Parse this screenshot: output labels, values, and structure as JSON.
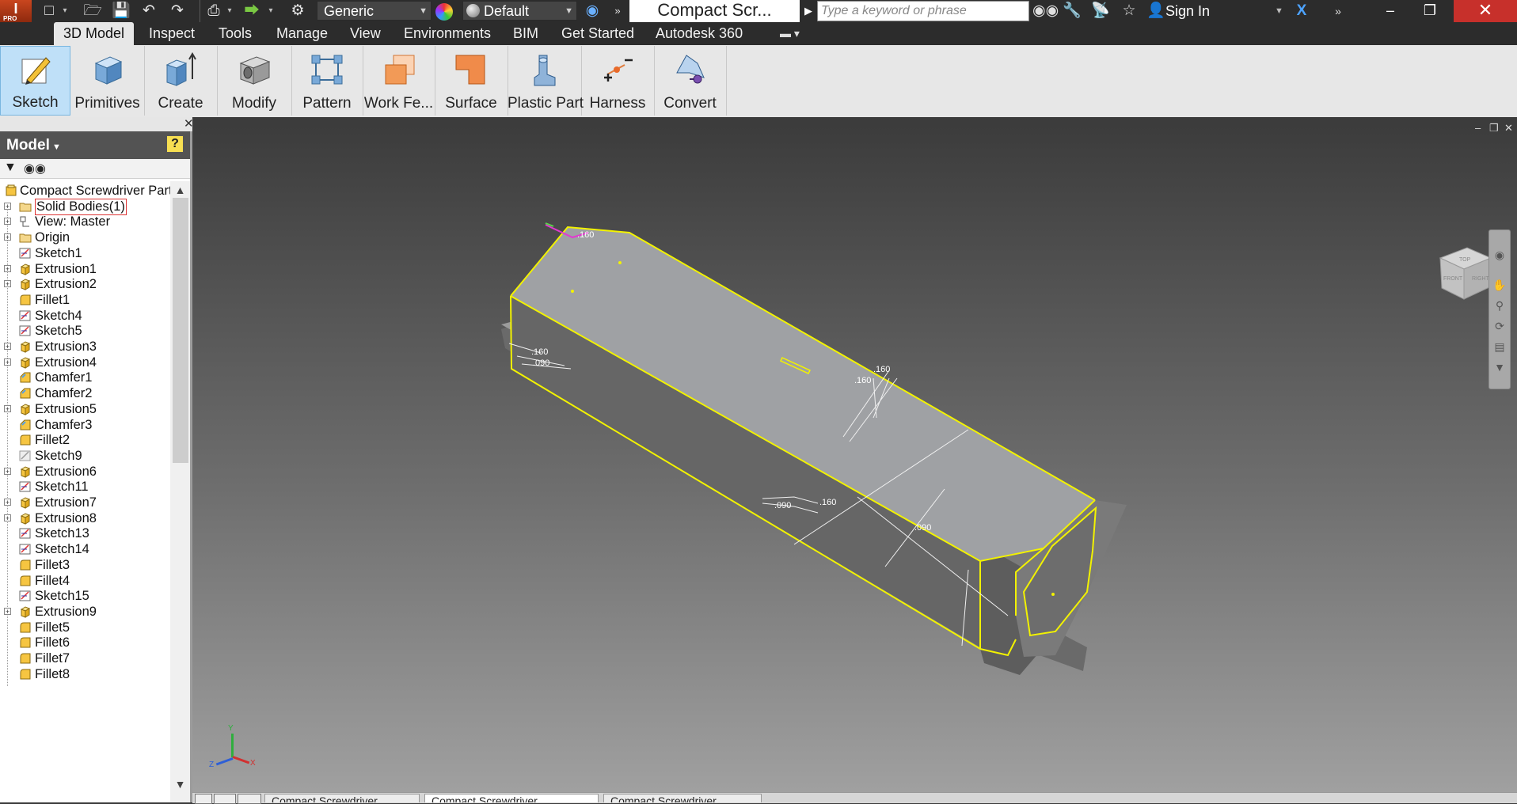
{
  "app": {
    "logo_letter": "I",
    "logo_badge": "PRO",
    "document_title": "Compact Scr...",
    "search_placeholder": "Type a keyword or phrase",
    "sign_in": "Sign In"
  },
  "quick_access": {
    "material_dropdown": "Generic",
    "appearance_dropdown": "Default"
  },
  "ribbon_tabs": [
    {
      "label": "3D Model",
      "active": true
    },
    {
      "label": "Inspect"
    },
    {
      "label": "Tools"
    },
    {
      "label": "Manage"
    },
    {
      "label": "View"
    },
    {
      "label": "Environments"
    },
    {
      "label": "BIM"
    },
    {
      "label": "Get Started"
    },
    {
      "label": "Autodesk 360"
    }
  ],
  "ribbon_panels": [
    {
      "label": "Sketch",
      "icon": "sketch-icon",
      "active": true
    },
    {
      "label": "Primitives",
      "icon": "box-primitive-icon"
    },
    {
      "label": "Create",
      "icon": "extrude-create-icon"
    },
    {
      "label": "Modify",
      "icon": "modify-hole-icon"
    },
    {
      "label": "Pattern",
      "icon": "pattern-icon"
    },
    {
      "label": "Work Fe...",
      "icon": "work-feature-icon"
    },
    {
      "label": "Surface",
      "icon": "surface-icon"
    },
    {
      "label": "Plastic Part",
      "icon": "plastic-part-icon"
    },
    {
      "label": "Harness",
      "icon": "harness-icon"
    },
    {
      "label": "Convert",
      "icon": "convert-icon"
    }
  ],
  "browser": {
    "title": "Model",
    "help_glyph": "?",
    "items": [
      {
        "label": "Compact Screwdriver Part",
        "icon": "part",
        "root": true
      },
      {
        "label": "Solid Bodies(1)",
        "icon": "folder",
        "expand": true,
        "highlight": true
      },
      {
        "label": "View: Master",
        "icon": "view",
        "expand": true
      },
      {
        "label": "Origin",
        "icon": "folder",
        "expand": true
      },
      {
        "label": "Sketch1",
        "icon": "sketch"
      },
      {
        "label": "Extrusion1",
        "icon": "extrusion",
        "expand": true
      },
      {
        "label": "Extrusion2",
        "icon": "extrusion",
        "expand": true
      },
      {
        "label": "Fillet1",
        "icon": "fillet"
      },
      {
        "label": "Sketch4",
        "icon": "sketch"
      },
      {
        "label": "Sketch5",
        "icon": "sketch"
      },
      {
        "label": "Extrusion3",
        "icon": "extrusion",
        "expand": true
      },
      {
        "label": "Extrusion4",
        "icon": "extrusion",
        "expand": true
      },
      {
        "label": "Chamfer1",
        "icon": "chamfer"
      },
      {
        "label": "Chamfer2",
        "icon": "chamfer"
      },
      {
        "label": "Extrusion5",
        "icon": "extrusion",
        "expand": true
      },
      {
        "label": "Chamfer3",
        "icon": "chamfer"
      },
      {
        "label": "Fillet2",
        "icon": "fillet"
      },
      {
        "label": "Sketch9",
        "icon": "sketch-gray"
      },
      {
        "label": "Extrusion6",
        "icon": "extrusion",
        "expand": true
      },
      {
        "label": "Sketch11",
        "icon": "sketch"
      },
      {
        "label": "Extrusion7",
        "icon": "extrusion",
        "expand": true
      },
      {
        "label": "Extrusion8",
        "icon": "extrusion",
        "expand": true
      },
      {
        "label": "Sketch13",
        "icon": "sketch"
      },
      {
        "label": "Sketch14",
        "icon": "sketch"
      },
      {
        "label": "Fillet3",
        "icon": "fillet"
      },
      {
        "label": "Fillet4",
        "icon": "fillet"
      },
      {
        "label": "Sketch15",
        "icon": "sketch"
      },
      {
        "label": "Extrusion9",
        "icon": "extrusion",
        "expand": true
      },
      {
        "label": "Fillet5",
        "icon": "fillet"
      },
      {
        "label": "Fillet6",
        "icon": "fillet"
      },
      {
        "label": "Fillet7",
        "icon": "fillet"
      },
      {
        "label": "Fillet8",
        "icon": "fillet"
      }
    ]
  },
  "viewcube": {
    "top": "TOP",
    "front": "FRONT",
    "right": "RIGHT"
  },
  "dimensions": {
    "d_top": ".160",
    "d_a": ".160",
    "d_b": ".090",
    "d_c": ".160",
    "d_d": ".160",
    "d_e": ".090",
    "d_f": ".160",
    "d_g": ".090"
  },
  "axis": {
    "x": "X",
    "y": "Y",
    "z": "Z"
  },
  "doc_tabs": [
    "Compact Screwdriver...",
    "Compact Screwdriver...",
    "Compact Screwdriver..."
  ],
  "colors": {
    "highlight_edge": "#f2f200",
    "ribbon_bg": "#e7e7e7",
    "titlebar_bg": "#2c2c2c",
    "close_red": "#c7302b"
  }
}
